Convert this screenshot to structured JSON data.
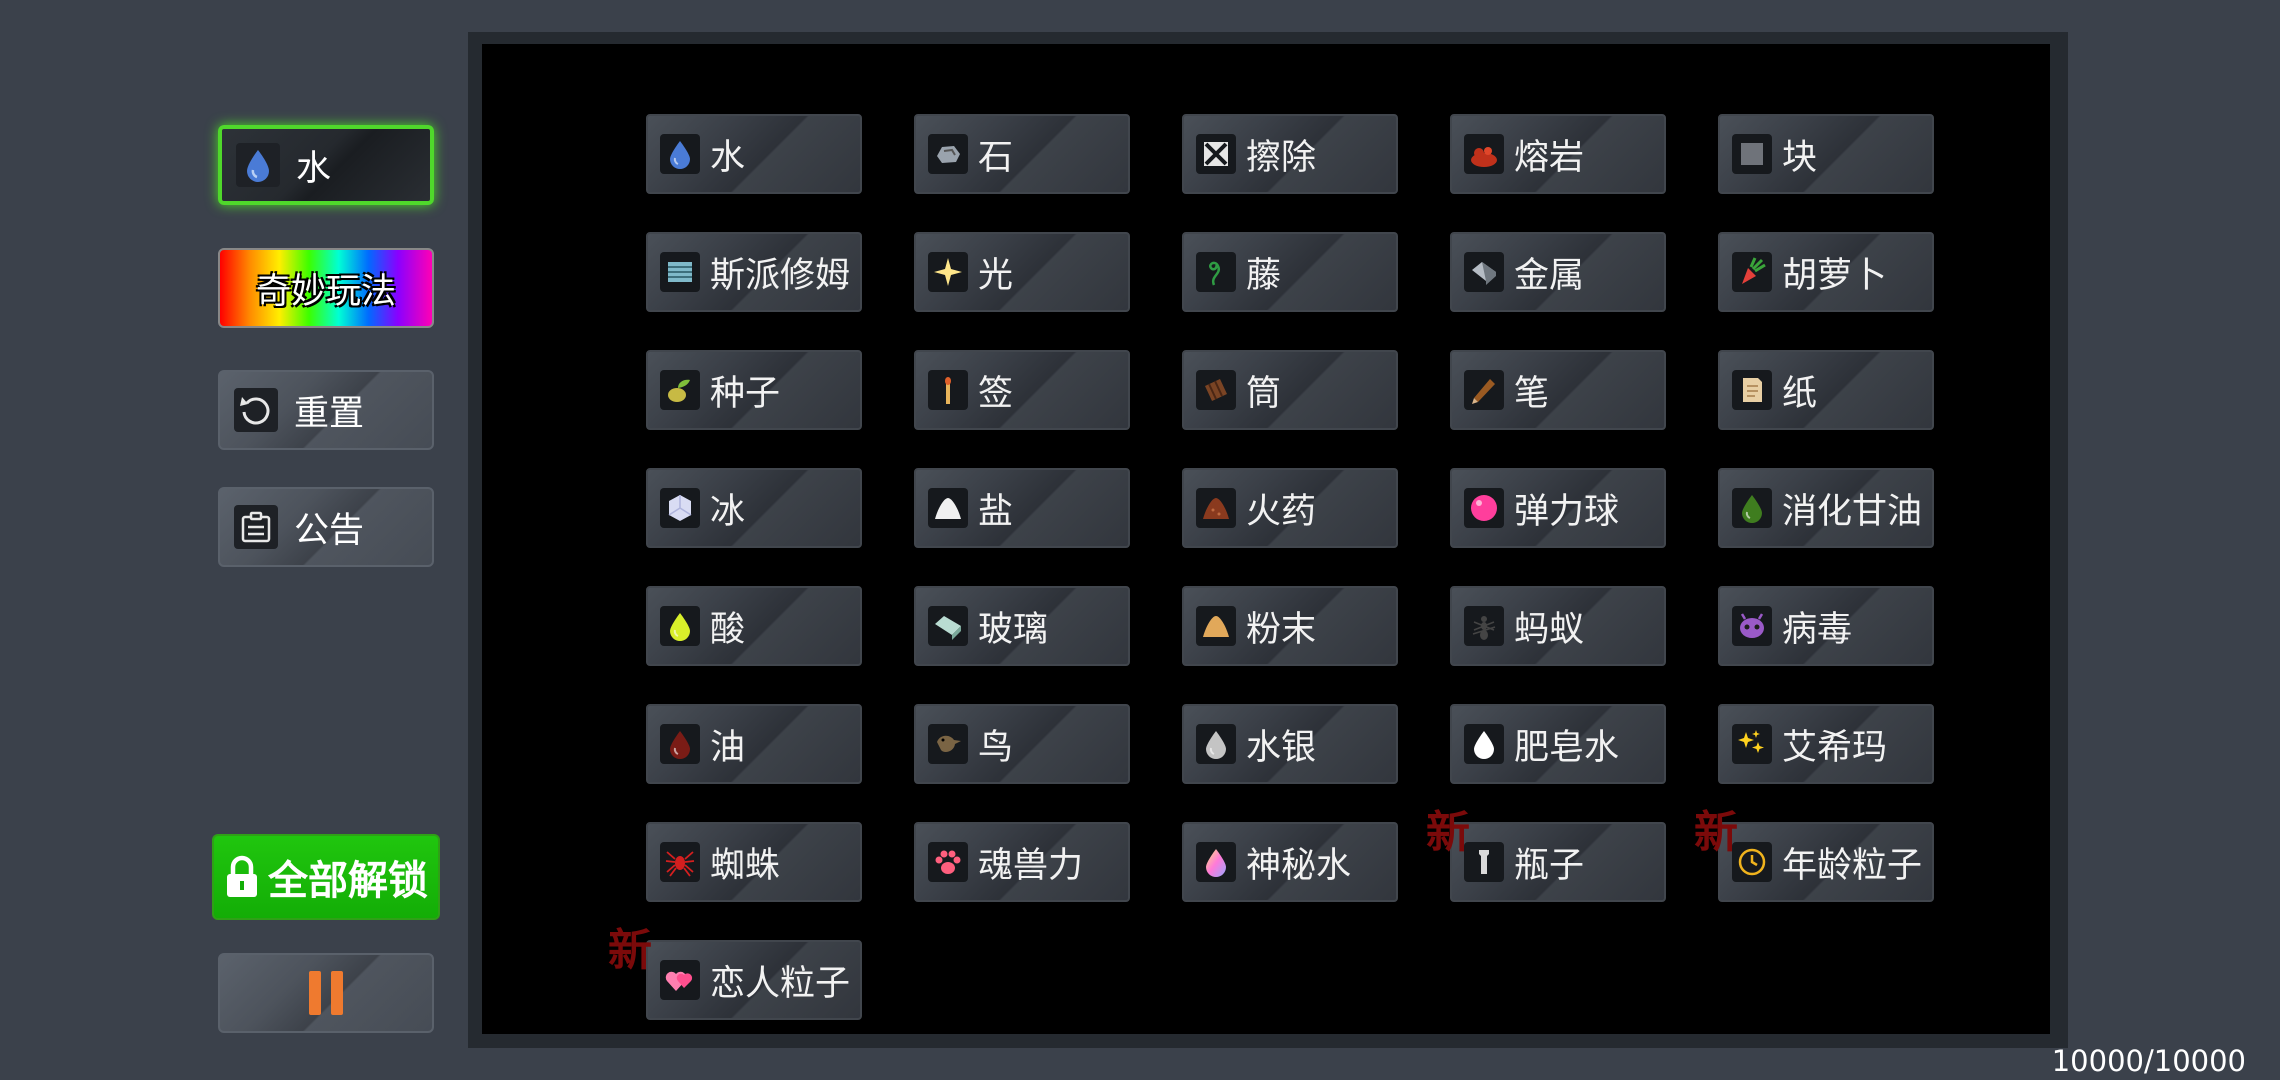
{
  "sidebar": {
    "selected_label": "水",
    "fun_label": "奇妙玩法",
    "reset_label": "重置",
    "notice_label": "公告",
    "unlock_label": "全部解锁"
  },
  "counter": "10000/10000",
  "new_badge": "新",
  "elements": [
    {
      "label": "水",
      "icon": "water-drop-icon",
      "color": "#4a7bd6"
    },
    {
      "label": "石",
      "icon": "stone-icon",
      "color": "#9aa3ad"
    },
    {
      "label": "擦除",
      "icon": "eraser-icon",
      "color": "#e6e6e6"
    },
    {
      "label": "熔岩",
      "icon": "lava-icon",
      "color": "#c0311b"
    },
    {
      "label": "块",
      "icon": "block-icon",
      "color": "#6f737a"
    },
    {
      "label": "斯派修姆",
      "icon": "spacium-icon",
      "color": "#7fb9c9"
    },
    {
      "label": "光",
      "icon": "light-sparkle-icon",
      "color": "#ffe68a"
    },
    {
      "label": "藤",
      "icon": "vine-icon",
      "color": "#2f9b43"
    },
    {
      "label": "金属",
      "icon": "metal-icon",
      "color": "#b5bcc4"
    },
    {
      "label": "胡萝卜",
      "icon": "carrot-icon",
      "color": "#e4403a"
    },
    {
      "label": "种子",
      "icon": "seed-icon",
      "color": "#c7ba44"
    },
    {
      "label": "签",
      "icon": "match-stick-icon",
      "color": "#e0602a"
    },
    {
      "label": "筒",
      "icon": "tube-icon",
      "color": "#7a4424"
    },
    {
      "label": "笔",
      "icon": "pencil-icon",
      "color": "#9a5a22"
    },
    {
      "label": "纸",
      "icon": "paper-icon",
      "color": "#e8cfa4"
    },
    {
      "label": "冰",
      "icon": "ice-icon",
      "color": "#d9dcf3"
    },
    {
      "label": "盐",
      "icon": "salt-icon",
      "color": "#f0f0f0"
    },
    {
      "label": "火药",
      "icon": "gunpowder-icon",
      "color": "#8a3a1e"
    },
    {
      "label": "弹力球",
      "icon": "bouncy-ball-icon",
      "color": "#ff3e9c"
    },
    {
      "label": "消化甘油",
      "icon": "nitroglycerin-icon",
      "color": "#3f7d1f"
    },
    {
      "label": "酸",
      "icon": "acid-drop-icon",
      "color": "#d9f02a"
    },
    {
      "label": "玻璃",
      "icon": "glass-icon",
      "color": "#b9dcd2"
    },
    {
      "label": "粉末",
      "icon": "powder-icon",
      "color": "#e1a85a"
    },
    {
      "label": "蚂蚁",
      "icon": "ant-icon",
      "color": "#444444"
    },
    {
      "label": "病毒",
      "icon": "virus-icon",
      "color": "#9a5ac8"
    },
    {
      "label": "油",
      "icon": "oil-drop-icon",
      "color": "#7a1c16"
    },
    {
      "label": "鸟",
      "icon": "bird-icon",
      "color": "#7a6444"
    },
    {
      "label": "水银",
      "icon": "mercury-drop-icon",
      "color": "#c4c4c4"
    },
    {
      "label": "肥皂水",
      "icon": "soap-water-drop-icon",
      "color": "#ffffff"
    },
    {
      "label": "艾希玛",
      "icon": "sparkles-icon",
      "color": "#ffd21f"
    },
    {
      "label": "蜘蛛",
      "icon": "spider-icon",
      "color": "#d41f1f"
    },
    {
      "label": "魂兽力",
      "icon": "paw-icon",
      "color": "#ff5f7e"
    },
    {
      "label": "神秘水",
      "icon": "mystic-water-icon",
      "color": "#9aa6ff"
    },
    {
      "label": "瓶子",
      "icon": "bottle-icon",
      "color": "#d9d9d9"
    },
    {
      "label": "年龄粒子",
      "icon": "clock-icon",
      "color": "#f0b31d"
    },
    {
      "label": "恋人粒子",
      "icon": "hearts-icon",
      "color": "#ff7fb0"
    }
  ]
}
